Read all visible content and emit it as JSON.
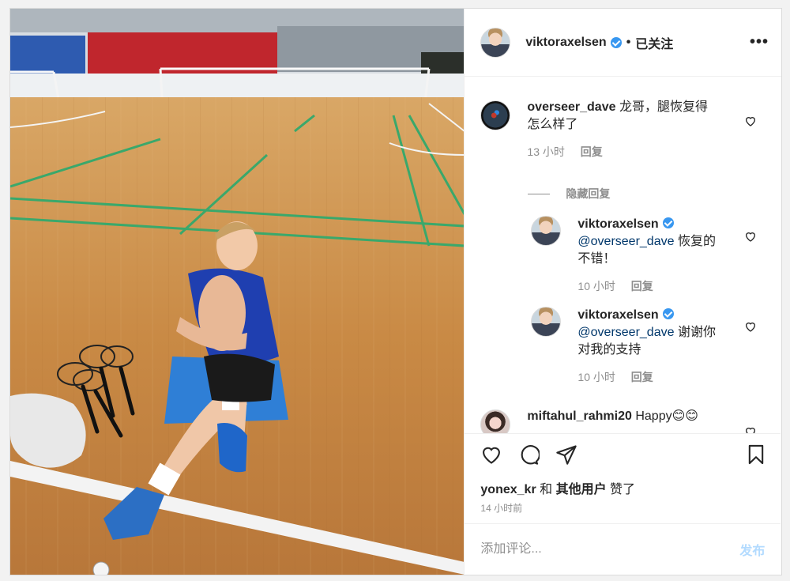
{
  "post": {
    "author": "viktoraxelsen",
    "separator": "•",
    "follow_status": "已关注",
    "more_label": "•••"
  },
  "comments": [
    {
      "username": "overseer_dave",
      "text": "龙哥，腿恢复得怎么样了",
      "time": "13 小时",
      "reply_label": "回复"
    }
  ],
  "hide_replies_label": "隐藏回复",
  "replies": [
    {
      "username": "viktoraxelsen",
      "mention": "@overseer_dave",
      "text": " 恢复的不错！",
      "time": "10 小时",
      "reply_label": "回复"
    },
    {
      "username": "viktoraxelsen",
      "mention": "@overseer_dave",
      "text": " 谢谢你对我的支持",
      "time": "10 小时",
      "reply_label": "回复"
    }
  ],
  "partial_comment": {
    "username": "miftahul_rahmi20",
    "text": "Happy😊😊"
  },
  "likes": {
    "user": "yonex_kr",
    "and": " 和 ",
    "others": "其他用户",
    "suffix": " 赞了"
  },
  "post_time": "14 小时前",
  "add_comment": {
    "placeholder": "添加评论...",
    "post_label": "发布"
  },
  "icons": [
    "more-icon",
    "heart-icon",
    "comment-icon",
    "share-icon",
    "bookmark-icon",
    "verified-badge-icon"
  ],
  "colors": {
    "verified": "#3897f0",
    "link": "#00376b",
    "muted": "#8e8e8e",
    "post_disabled": "#b3dbff"
  }
}
